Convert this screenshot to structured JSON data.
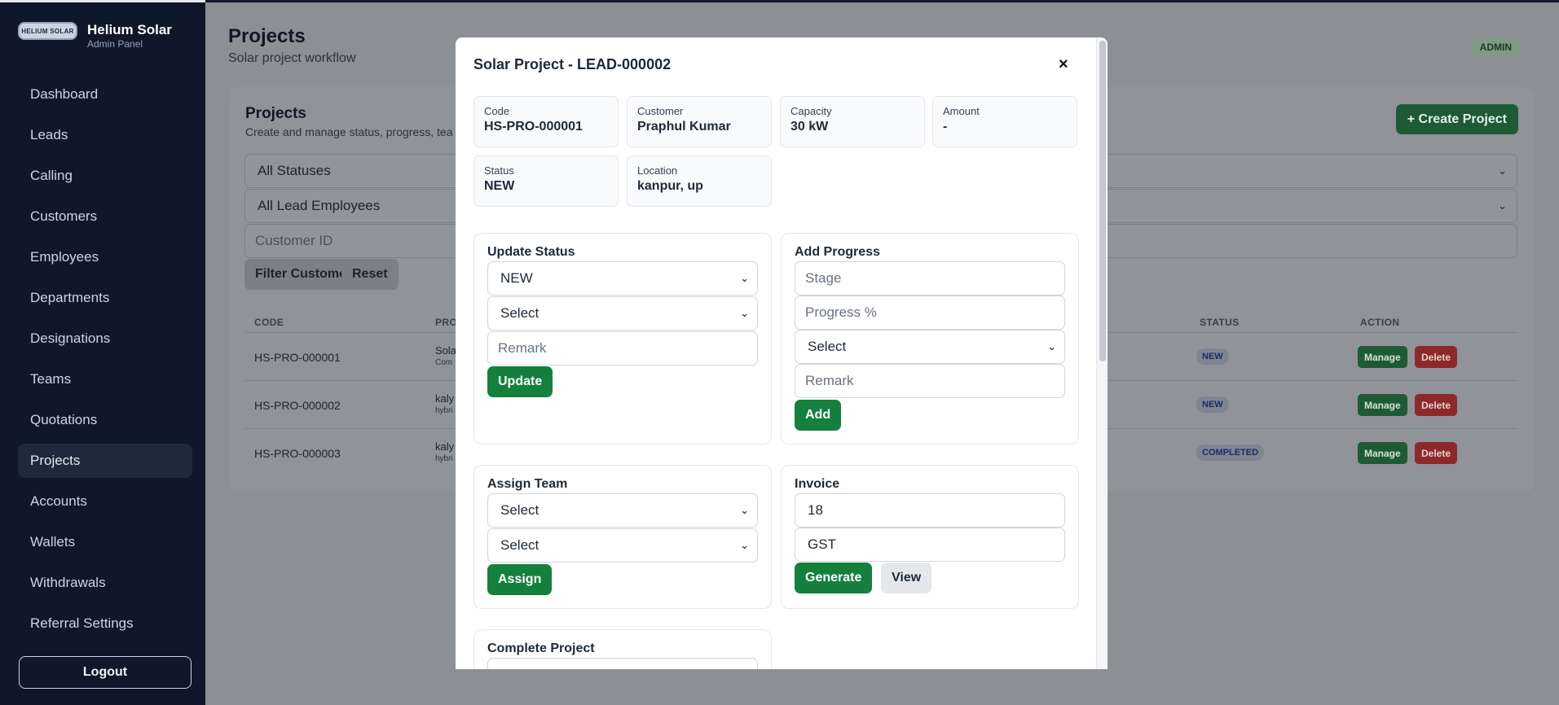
{
  "brand": {
    "logo_text": "HELIUM SOLAR",
    "title": "Helium Solar",
    "subtitle": "Admin Panel"
  },
  "nav": [
    {
      "label": "Dashboard"
    },
    {
      "label": "Leads"
    },
    {
      "label": "Calling"
    },
    {
      "label": "Customers"
    },
    {
      "label": "Employees"
    },
    {
      "label": "Departments"
    },
    {
      "label": "Designations"
    },
    {
      "label": "Teams"
    },
    {
      "label": "Quotations"
    },
    {
      "label": "Projects",
      "active": true
    },
    {
      "label": "Accounts"
    },
    {
      "label": "Wallets"
    },
    {
      "label": "Withdrawals"
    },
    {
      "label": "Referral Settings"
    }
  ],
  "logout_label": "Logout",
  "page": {
    "title": "Projects",
    "subtitle": "Solar project workflow",
    "role_badge": "ADMIN"
  },
  "card": {
    "title": "Projects",
    "subtitle": "Create and manage status, progress, tea",
    "create_button": "+ Create Project",
    "filters": {
      "status": "All Statuses",
      "employees": "All Lead Employees",
      "customer_id_placeholder": "Customer ID"
    },
    "filter_button": "Filter Customer",
    "reset_button": "Reset",
    "columns": {
      "code": "CODE",
      "project": "PRO",
      "status": "STATUS",
      "action": "ACTION"
    },
    "rows": [
      {
        "code": "HS-PRO-000001",
        "project": "Sola",
        "project_sub": "Com",
        "status": "NEW"
      },
      {
        "code": "HS-PRO-000002",
        "project": "kaly",
        "project_sub": "hybri",
        "status": "NEW"
      },
      {
        "code": "HS-PRO-000003",
        "project": "kaly",
        "project_sub": "hybri",
        "status": "COMPLETED"
      }
    ],
    "manage_label": "Manage",
    "delete_label": "Delete"
  },
  "modal": {
    "title": "Solar Project - LEAD-000002",
    "close_symbol": "×",
    "info": {
      "code": {
        "label": "Code",
        "value": "HS-PRO-000001"
      },
      "customer": {
        "label": "Customer",
        "value": "Praphul Kumar"
      },
      "capacity": {
        "label": "Capacity",
        "value": "30 kW"
      },
      "amount": {
        "label": "Amount",
        "value": "-"
      },
      "status": {
        "label": "Status",
        "value": "NEW"
      },
      "location": {
        "label": "Location",
        "value": "kanpur, up"
      }
    },
    "update_status": {
      "title": "Update Status",
      "status_value": "NEW",
      "select_value": "Select",
      "remark_placeholder": "Remark",
      "button": "Update"
    },
    "add_progress": {
      "title": "Add Progress",
      "stage_placeholder": "Stage",
      "progress_placeholder": "Progress %",
      "select_value": "Select",
      "remark_placeholder": "Remark",
      "button": "Add"
    },
    "assign_team": {
      "title": "Assign Team",
      "select1": "Select",
      "select2": "Select",
      "button": "Assign"
    },
    "invoice": {
      "title": "Invoice",
      "value1": "18",
      "value2": "GST",
      "generate_button": "Generate",
      "view_button": "View"
    },
    "complete_project": {
      "title": "Complete Project"
    }
  }
}
